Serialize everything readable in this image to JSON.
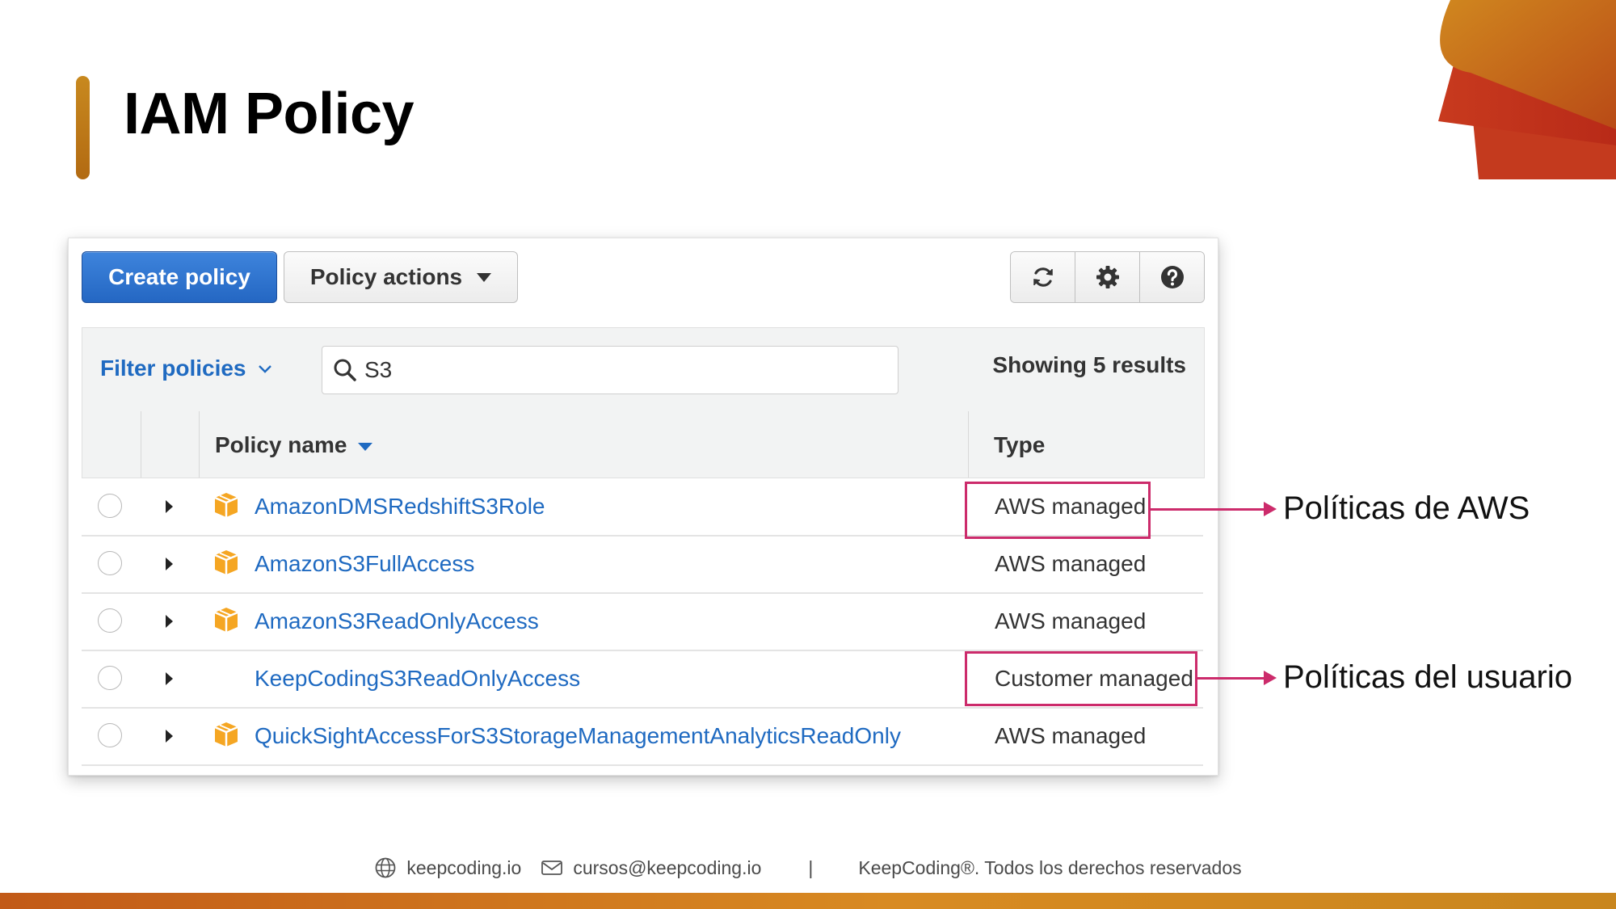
{
  "slide": {
    "title": "IAM Policy"
  },
  "toolbar": {
    "create_label": "Create policy",
    "actions_label": "Policy actions",
    "icons": [
      "refresh-icon",
      "gear-icon",
      "help-icon"
    ]
  },
  "filter": {
    "label": "Filter policies",
    "search_value": "S3",
    "results": "Showing 5 results"
  },
  "table": {
    "columns": [
      "Policy name",
      "Type"
    ],
    "rows": [
      {
        "name": "AmazonDMSRedshiftS3Role",
        "type": "AWS managed",
        "icon": "package-icon"
      },
      {
        "name": "AmazonS3FullAccess",
        "type": "AWS managed",
        "icon": "package-icon"
      },
      {
        "name": "AmazonS3ReadOnlyAccess",
        "type": "AWS managed",
        "icon": "package-icon"
      },
      {
        "name": "KeepCodingS3ReadOnlyAccess",
        "type": "Customer managed",
        "icon": ""
      },
      {
        "name": "QuickSightAccessForS3StorageManagementAnalyticsReadOnly",
        "type": "AWS managed",
        "icon": "package-icon"
      }
    ]
  },
  "annotations": {
    "aws": "Políticas de AWS",
    "user": "Políticas del usuario"
  },
  "footer": {
    "site": "keepcoding.io",
    "email": "cursos@keepcoding.io",
    "separator": "|",
    "rights": "KeepCoding®. Todos los derechos reservados"
  },
  "colors": {
    "accent": "#cc2b6b",
    "link": "#1f6ac1",
    "primary_button": "#2a6fcb",
    "brand_orange": "#c8891f"
  }
}
